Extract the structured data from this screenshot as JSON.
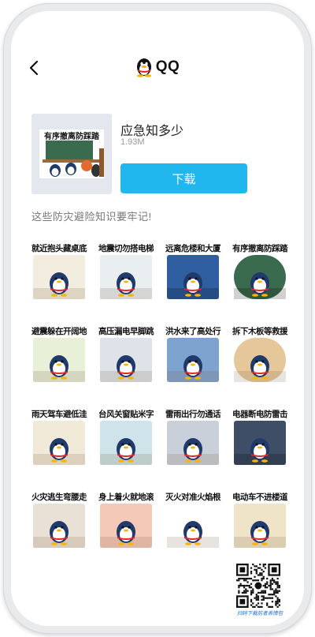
{
  "header": {
    "title": "QQ",
    "back_icon": "chevron-left-icon",
    "logo_icon": "qq-penguin-logo"
  },
  "pack": {
    "name": "应急知多少",
    "size": "1.93M",
    "cover_text": "有序撤离防踩踏",
    "download_label": "下载",
    "download_color": "#20b6ee",
    "description": "这些防灾避险知识要牢记!"
  },
  "stickers": [
    {
      "caption": "就近抱头藏桌底",
      "bg": "#f3ede0"
    },
    {
      "caption": "地震切勿搭电梯",
      "bg": "#e9eef0"
    },
    {
      "caption": "远离危楼和大厦",
      "bg": "#2f5fa0"
    },
    {
      "caption": "有序撤离防踩踏",
      "bg": "#3a6b4e"
    },
    {
      "caption": "避震躲在开阔地",
      "bg": "#e8f0d8"
    },
    {
      "caption": "高压漏电早脚跳",
      "bg": "#dde3e8"
    },
    {
      "caption": "洪水来了高处行",
      "bg": "#7fa3cf"
    },
    {
      "caption": "拆下木板等救援",
      "bg": "#e6c79a"
    },
    {
      "caption": "雨天驾车避低洼",
      "bg": "#f2ead8"
    },
    {
      "caption": "台风关窗贴米字",
      "bg": "#cfe3ea"
    },
    {
      "caption": "雷雨出行勿通话",
      "bg": "#c9d0da"
    },
    {
      "caption": "电器断电防雷击",
      "bg": "#3d4e66"
    },
    {
      "caption": "火灾逃生弯腰走",
      "bg": "#e9e1d6"
    },
    {
      "caption": "身上着火就地滚",
      "bg": "#f4c9b8"
    },
    {
      "caption": "灭火对准火焰根",
      "bg": "#ffffff"
    },
    {
      "caption": "电动车不进楼道",
      "bg": "#f0e4c8"
    }
  ],
  "qr": {
    "caption": "扫码下载前者表情包"
  }
}
